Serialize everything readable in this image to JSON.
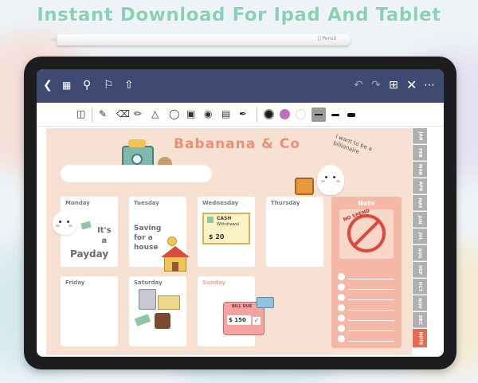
{
  "headline": "Instant Download For Ipad And Tablet",
  "pencil_brand": "Pencil",
  "appbar": {
    "icons": [
      "back-icon",
      "grid-icon",
      "search-icon",
      "bookmark-icon",
      "share-icon",
      "undo-icon",
      "redo-icon",
      "add-page-icon",
      "close-icon",
      "more-icon"
    ]
  },
  "toolbar": {
    "tools": [
      "layout-icon",
      "pen-icon",
      "eraser-icon",
      "highlighter-icon",
      "shapes-icon",
      "lasso-icon",
      "image-icon",
      "camera-icon",
      "text-icon",
      "eyedropper-icon"
    ],
    "colors": [
      "#1a1a1a",
      "#c070b8",
      "#ffffff"
    ]
  },
  "planner": {
    "brand": "Babanana & Co",
    "bubble": "I want to be a billionaire",
    "days": [
      {
        "label": "Monday"
      },
      {
        "label": "Tuesday"
      },
      {
        "label": "Wednesday"
      },
      {
        "label": "Thursday"
      },
      {
        "label": "Friday"
      },
      {
        "label": "Saturday"
      },
      {
        "label": "Sunday"
      }
    ],
    "monday_note": [
      "It's",
      "a",
      "Payday"
    ],
    "tuesday_note": [
      "Saving",
      "for a",
      "house"
    ],
    "cash_slip": {
      "title": "CASH",
      "subtitle": "Withdrawal",
      "amount": "$ 20"
    },
    "bill": {
      "title": "BILL DUE",
      "amount": "$ 150"
    },
    "note": {
      "label": "Note",
      "badge": "NO SPEND"
    }
  },
  "months": [
    "JAN",
    "FEB",
    "MAR",
    "APR",
    "MAY",
    "JUN",
    "JUL",
    "AUG",
    "SEP",
    "OCT",
    "NOV",
    "DEC",
    "NOTE"
  ],
  "colors": {
    "headline": "#86d2b3",
    "appbar": "#3f4a73",
    "page": "#f7e1d3",
    "brand": "#e9907a",
    "note_panel": "#f6b8a6",
    "tab": "#b0b0b0",
    "note_tab": "#e96a54"
  }
}
